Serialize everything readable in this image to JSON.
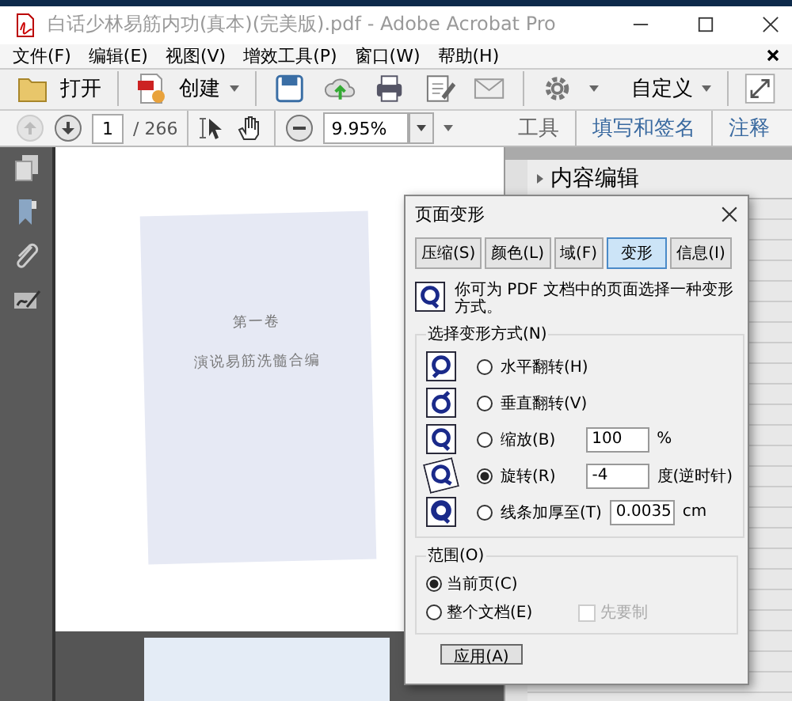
{
  "window": {
    "title": "白话少林易筋内功(真本)(完美版).pdf - Adobe Acrobat Pro"
  },
  "menu": [
    "文件(F)",
    "编辑(E)",
    "视图(V)",
    "增效工具(P)",
    "窗口(W)",
    "帮助(H)"
  ],
  "toolbar": {
    "open": "打开",
    "create": "创建",
    "customize": "自定义"
  },
  "nav": {
    "page": "1",
    "page_count": "/ 266",
    "zoom": "9.95%",
    "tabs": [
      "工具",
      "填写和签名",
      "注释"
    ]
  },
  "document": {
    "page_lines": [
      "第一卷",
      "演说易筋洗髓合编"
    ]
  },
  "right_panel": {
    "section": "内容编辑"
  },
  "dialog": {
    "title": "页面变形",
    "tabs": [
      {
        "label": "压缩(S)",
        "selected": false
      },
      {
        "label": "颜色(L)",
        "selected": false
      },
      {
        "label": "域(F)",
        "selected": false
      },
      {
        "label": "变形",
        "selected": true
      },
      {
        "label": "信息(I)",
        "selected": false
      }
    ],
    "intro": "你可为 PDF 文档中的页面选择一种变形方式。",
    "method_group": "选择变形方式(N)",
    "methods": [
      {
        "label": "水平翻转(H)",
        "selected": false
      },
      {
        "label": "垂直翻转(V)",
        "selected": false
      },
      {
        "label": "缩放(B)",
        "selected": false,
        "value": "100",
        "unit": "%"
      },
      {
        "label": "旋转(R)",
        "selected": true,
        "value": "-4",
        "unit": "度(逆时针)"
      },
      {
        "label": "线条加厚至(T)",
        "selected": false,
        "value": "0.0035",
        "unit": "cm"
      }
    ],
    "range_group": "范围(O)",
    "ranges": [
      {
        "label": "当前页(C)",
        "selected": true
      },
      {
        "label": "整个文档(E)",
        "selected": false
      }
    ],
    "option": {
      "label": "先要制",
      "checked": false,
      "disabled": true
    },
    "buttons": [
      "应用(A)"
    ]
  }
}
